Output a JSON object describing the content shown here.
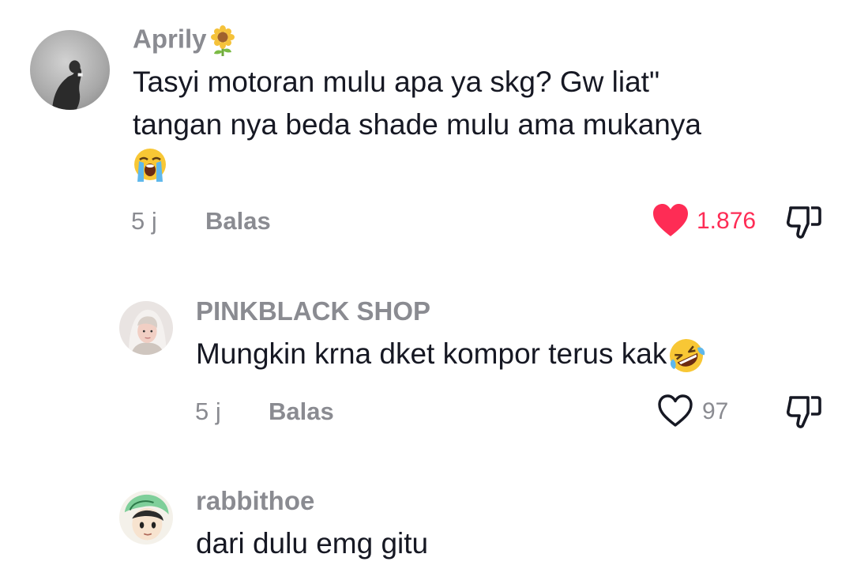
{
  "comments": [
    {
      "username": "Aprily",
      "username_emoji": "sunflower",
      "text_lines": [
        "Tasyi motoran mulu apa ya skg? Gw liat\"",
        "tangan nya beda shade mulu ama mukanya"
      ],
      "trailing_emoji": "loudly-crying-face",
      "time": "5 j",
      "reply_label": "Balas",
      "like_count": "1.876",
      "liked": true
    },
    {
      "username": "PINKBLACK SHOP",
      "text_lines": [
        "Mungkin krna dket kompor terus kak"
      ],
      "trailing_emoji": "rolling-on-floor-laughing-face",
      "time": "5 j",
      "reply_label": "Balas",
      "like_count": "97",
      "liked": false
    },
    {
      "username": "rabbithoe",
      "text_lines": [
        "dari dulu emg gitu"
      ]
    }
  ],
  "colors": {
    "text_primary": "#161823",
    "text_secondary": "#8a8b91",
    "like_active": "#fe2c55"
  }
}
